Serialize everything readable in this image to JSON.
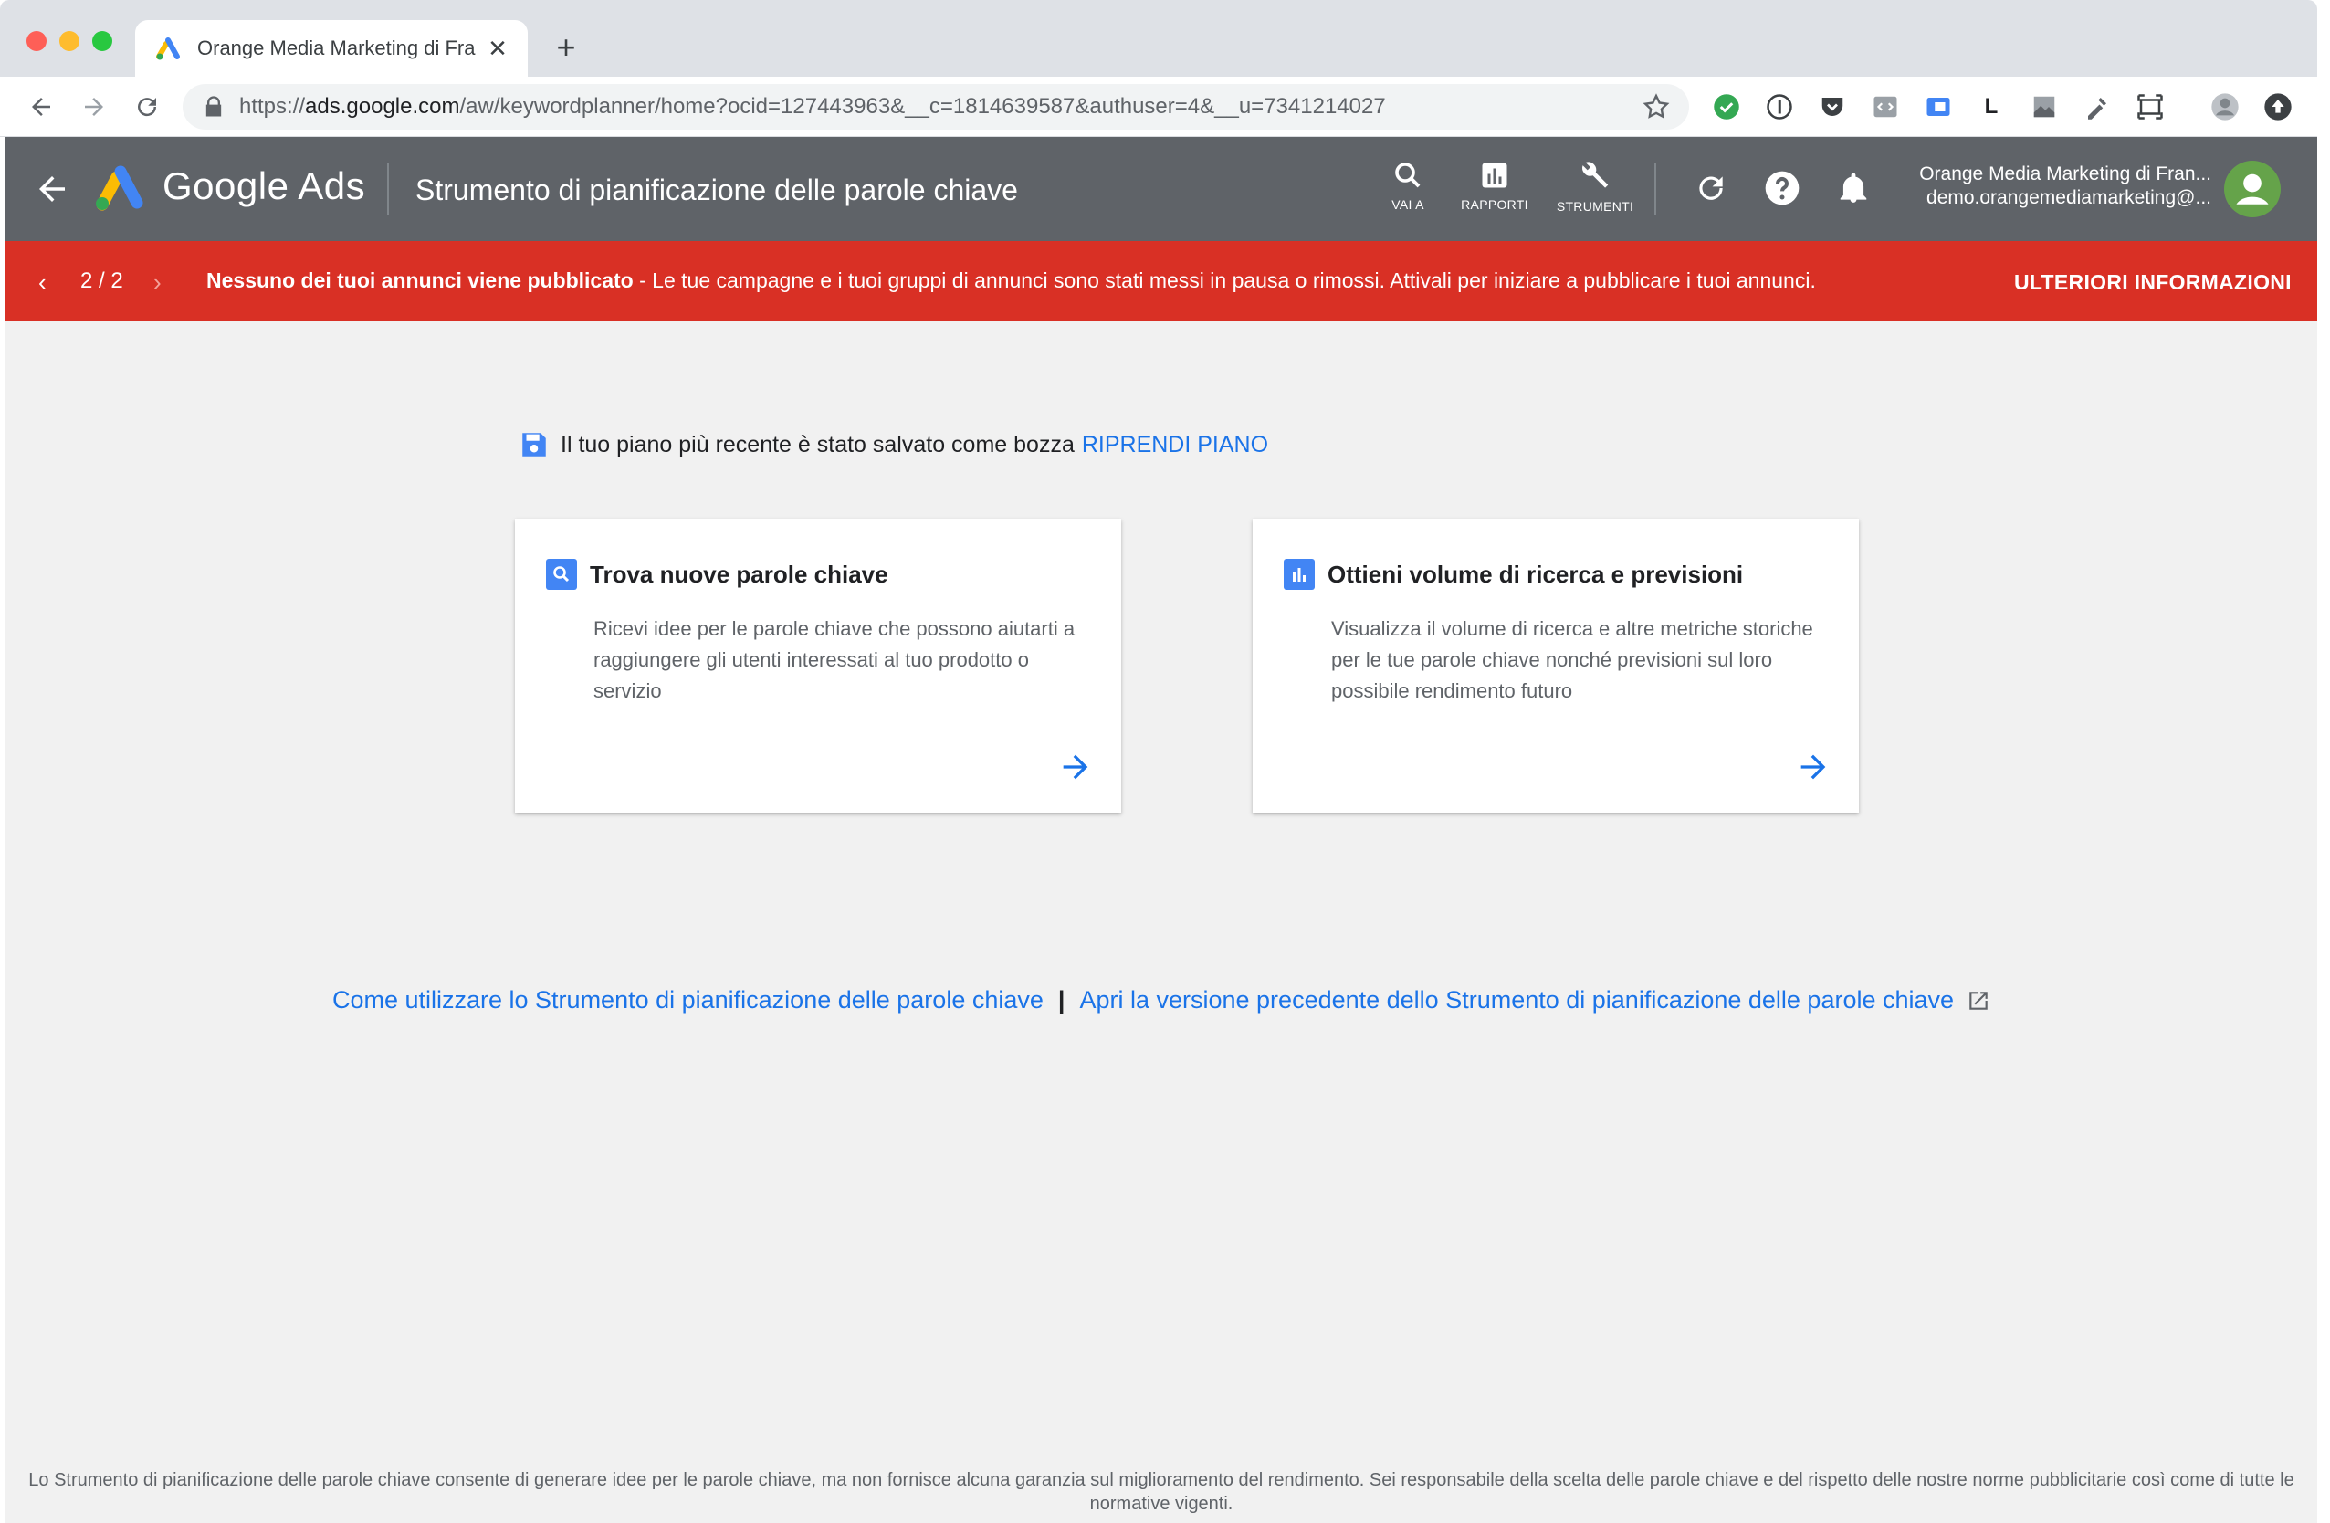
{
  "browser": {
    "tab_title": "Orange Media Marketing di Fra",
    "url_prefix": "https://",
    "url_host": "ads.google.com",
    "url_path": "/aw/keywordplanner/home?ocid=127443963&__c=1814639587&authuser=4&__u=7341214027",
    "extension_letter": "L"
  },
  "header": {
    "brand": "Google Ads",
    "page_title": "Strumento di pianificazione delle parole chiave",
    "tools": [
      {
        "label": "VAI A",
        "icon": "search-icon"
      },
      {
        "label": "RAPPORTI",
        "icon": "bar-chart-icon"
      },
      {
        "label": "STRUMENTI",
        "icon": "wrench-icon"
      }
    ],
    "account_name": "Orange Media Marketing di Fran...",
    "account_email": "demo.orangemediamarketing@..."
  },
  "alert": {
    "counter": "2 / 2",
    "title": "Nessuno dei tuoi annunci viene pubblicato",
    "message": " - Le tue campagne e i tuoi gruppi di annunci sono stati messi in pausa o rimossi. Attivali per iniziare a pubblicare i tuoi annunci.",
    "action": "ULTERIORI INFORMAZIONI",
    "color": "#d93025"
  },
  "draft": {
    "text": "Il tuo piano più recente è stato salvato come bozza",
    "action": "RIPRENDI PIANO"
  },
  "cards": [
    {
      "title": "Trova nuove parole chiave",
      "description": "Ricevi idee per le parole chiave che possono aiutarti a raggiungere gli utenti interessati al tuo prodotto o servizio",
      "icon": "search-icon"
    },
    {
      "title": "Ottieni volume di ricerca e previsioni",
      "description": "Visualizza il volume di ricerca e altre metriche storiche per le tue parole chiave nonché previsioni sul loro possibile rendimento futuro",
      "icon": "bar-chart-icon"
    }
  ],
  "help_links": {
    "how_to": "Come utilizzare lo Strumento di pianificazione delle parole chiave",
    "separator": "|",
    "previous_version": "Apri la versione precedente dello Strumento di pianificazione delle parole chiave"
  },
  "disclaimer": "Lo Strumento di pianificazione delle parole chiave consente di generare idee per le parole chiave, ma non fornisce alcuna garanzia sul miglioramento del rendimento. Sei responsabile della scelta delle parole chiave e del rispetto delle nostre norme pubblicitarie così come di tutte le normative vigenti.",
  "colors": {
    "header_bg": "#5f6368",
    "link": "#1a73e8",
    "content_bg": "#f1f1f1"
  }
}
